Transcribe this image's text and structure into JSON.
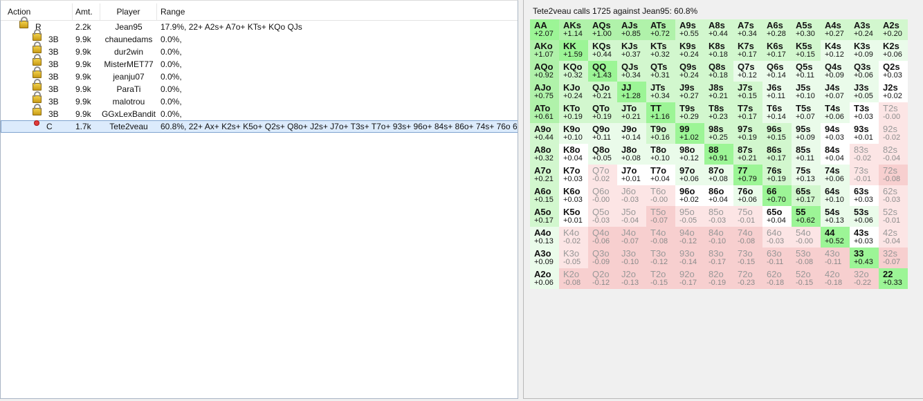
{
  "columns": {
    "action": "Action",
    "amt": "Amt.",
    "player": "Player",
    "range": "Range"
  },
  "rows": [
    {
      "icon": "lock-icon",
      "action": "R",
      "amt": "2.2k",
      "player": "Jean95",
      "range": "17.9%, 22+ A2s+ A7o+ KTs+ KQo QJs"
    },
    {
      "icon": "lock-icon",
      "action": "3B",
      "amt": "9.9k",
      "player": "chaunedams",
      "range": "0.0%,"
    },
    {
      "icon": "lock-icon",
      "action": "3B",
      "amt": "9.9k",
      "player": "dur2win",
      "range": "0.0%,"
    },
    {
      "icon": "lock-icon",
      "action": "3B",
      "amt": "9.9k",
      "player": "MisterMET77",
      "range": "0.0%,"
    },
    {
      "icon": "lock-icon",
      "action": "3B",
      "amt": "9.9k",
      "player": "jeanju07",
      "range": "0.0%,"
    },
    {
      "icon": "lock-icon",
      "action": "3B",
      "amt": "9.9k",
      "player": "ParaTi",
      "range": "0.0%,"
    },
    {
      "icon": "lock-icon",
      "action": "3B",
      "amt": "9.9k",
      "player": "malotrou",
      "range": "0.0%,"
    },
    {
      "icon": "lock-icon",
      "action": "3B",
      "amt": "9.9k",
      "player": "GGxLexBandit",
      "range": "0.0%,"
    },
    {
      "icon": "red-dot-icon",
      "action": "C",
      "amt": "1.7k",
      "player": "Tete2veau",
      "range": "60.8%, 22+ Ax+ K2s+ K5o+ Q2s+ Q8o+ J2s+ J7o+ T3s+ T7o+ 93s+ 96o+ 84s+ 86o+ 74s+ 76o 63s+ 6"
    }
  ],
  "colors": {
    "pocket": "#9cf596",
    "high": "#b0f2aa",
    "mid": "#d2f7ce",
    "low": "#eafbea",
    "neutral": "#ffffff",
    "neg_low": "#fce5e5",
    "neg_high": "#f7cfcf"
  },
  "matrix": {
    "title": "Tete2veau calls 1725 against Jean95: 60.8%",
    "rows": [
      [
        [
          "AA",
          "+2.07"
        ],
        [
          "AKs",
          "+1.14"
        ],
        [
          "AQs",
          "+1.00"
        ],
        [
          "AJs",
          "+0.85"
        ],
        [
          "ATs",
          "+0.72"
        ],
        [
          "A9s",
          "+0.55"
        ],
        [
          "A8s",
          "+0.44"
        ],
        [
          "A7s",
          "+0.34"
        ],
        [
          "A6s",
          "+0.28"
        ],
        [
          "A5s",
          "+0.30"
        ],
        [
          "A4s",
          "+0.27"
        ],
        [
          "A3s",
          "+0.24"
        ],
        [
          "A2s",
          "+0.20"
        ]
      ],
      [
        [
          "AKo",
          "+1.07"
        ],
        [
          "KK",
          "+1.59"
        ],
        [
          "KQs",
          "+0.44"
        ],
        [
          "KJs",
          "+0.37"
        ],
        [
          "KTs",
          "+0.32"
        ],
        [
          "K9s",
          "+0.24"
        ],
        [
          "K8s",
          "+0.18"
        ],
        [
          "K7s",
          "+0.17"
        ],
        [
          "K6s",
          "+0.17"
        ],
        [
          "K5s",
          "+0.15"
        ],
        [
          "K4s",
          "+0.12"
        ],
        [
          "K3s",
          "+0.09"
        ],
        [
          "K2s",
          "+0.06"
        ]
      ],
      [
        [
          "AQo",
          "+0.92"
        ],
        [
          "KQo",
          "+0.32"
        ],
        [
          "QQ",
          "+1.43"
        ],
        [
          "QJs",
          "+0.34"
        ],
        [
          "QTs",
          "+0.31"
        ],
        [
          "Q9s",
          "+0.24"
        ],
        [
          "Q8s",
          "+0.18"
        ],
        [
          "Q7s",
          "+0.12"
        ],
        [
          "Q6s",
          "+0.14"
        ],
        [
          "Q5s",
          "+0.11"
        ],
        [
          "Q4s",
          "+0.09"
        ],
        [
          "Q3s",
          "+0.06"
        ],
        [
          "Q2s",
          "+0.03"
        ]
      ],
      [
        [
          "AJo",
          "+0.75"
        ],
        [
          "KJo",
          "+0.24"
        ],
        [
          "QJo",
          "+0.21"
        ],
        [
          "JJ",
          "+1.28"
        ],
        [
          "JTs",
          "+0.34"
        ],
        [
          "J9s",
          "+0.27"
        ],
        [
          "J8s",
          "+0.21"
        ],
        [
          "J7s",
          "+0.15"
        ],
        [
          "J6s",
          "+0.11"
        ],
        [
          "J5s",
          "+0.10"
        ],
        [
          "J4s",
          "+0.07"
        ],
        [
          "J3s",
          "+0.05"
        ],
        [
          "J2s",
          "+0.02"
        ]
      ],
      [
        [
          "ATo",
          "+0.61"
        ],
        [
          "KTo",
          "+0.19"
        ],
        [
          "QTo",
          "+0.19"
        ],
        [
          "JTo",
          "+0.21"
        ],
        [
          "TT",
          "+1.16"
        ],
        [
          "T9s",
          "+0.29"
        ],
        [
          "T8s",
          "+0.23"
        ],
        [
          "T7s",
          "+0.17"
        ],
        [
          "T6s",
          "+0.14"
        ],
        [
          "T5s",
          "+0.07"
        ],
        [
          "T4s",
          "+0.06"
        ],
        [
          "T3s",
          "+0.03"
        ],
        [
          "T2s",
          "-0.00"
        ]
      ],
      [
        [
          "A9o",
          "+0.44"
        ],
        [
          "K9o",
          "+0.10"
        ],
        [
          "Q9o",
          "+0.11"
        ],
        [
          "J9o",
          "+0.14"
        ],
        [
          "T9o",
          "+0.16"
        ],
        [
          "99",
          "+1.02"
        ],
        [
          "98s",
          "+0.25"
        ],
        [
          "97s",
          "+0.19"
        ],
        [
          "96s",
          "+0.15"
        ],
        [
          "95s",
          "+0.09"
        ],
        [
          "94s",
          "+0.03"
        ],
        [
          "93s",
          "+0.01"
        ],
        [
          "92s",
          "-0.02"
        ]
      ],
      [
        [
          "A8o",
          "+0.32"
        ],
        [
          "K8o",
          "+0.04"
        ],
        [
          "Q8o",
          "+0.05"
        ],
        [
          "J8o",
          "+0.08"
        ],
        [
          "T8o",
          "+0.10"
        ],
        [
          "98o",
          "+0.12"
        ],
        [
          "88",
          "+0.91"
        ],
        [
          "87s",
          "+0.21"
        ],
        [
          "86s",
          "+0.17"
        ],
        [
          "85s",
          "+0.11"
        ],
        [
          "84s",
          "+0.04"
        ],
        [
          "83s",
          "-0.02"
        ],
        [
          "82s",
          "-0.04"
        ]
      ],
      [
        [
          "A7o",
          "+0.21"
        ],
        [
          "K7o",
          "+0.03"
        ],
        [
          "Q7o",
          "-0.02"
        ],
        [
          "J7o",
          "+0.01"
        ],
        [
          "T7o",
          "+0.04"
        ],
        [
          "97o",
          "+0.06"
        ],
        [
          "87o",
          "+0.08"
        ],
        [
          "77",
          "+0.79"
        ],
        [
          "76s",
          "+0.19"
        ],
        [
          "75s",
          "+0.13"
        ],
        [
          "74s",
          "+0.06"
        ],
        [
          "73s",
          "-0.01"
        ],
        [
          "72s",
          "-0.08"
        ]
      ],
      [
        [
          "A6o",
          "+0.15"
        ],
        [
          "K6o",
          "+0.03"
        ],
        [
          "Q6o",
          "-0.00"
        ],
        [
          "J6o",
          "-0.03"
        ],
        [
          "T6o",
          "-0.00"
        ],
        [
          "96o",
          "+0.02"
        ],
        [
          "86o",
          "+0.04"
        ],
        [
          "76o",
          "+0.06"
        ],
        [
          "66",
          "+0.70"
        ],
        [
          "65s",
          "+0.17"
        ],
        [
          "64s",
          "+0.10"
        ],
        [
          "63s",
          "+0.03"
        ],
        [
          "62s",
          "-0.03"
        ]
      ],
      [
        [
          "A5o",
          "+0.17"
        ],
        [
          "K5o",
          "+0.01"
        ],
        [
          "Q5o",
          "-0.03"
        ],
        [
          "J5o",
          "-0.04"
        ],
        [
          "T5o",
          "-0.07"
        ],
        [
          "95o",
          "-0.05"
        ],
        [
          "85o",
          "-0.03"
        ],
        [
          "75o",
          "-0.01"
        ],
        [
          "65o",
          "+0.04"
        ],
        [
          "55",
          "+0.62"
        ],
        [
          "54s",
          "+0.13"
        ],
        [
          "53s",
          "+0.06"
        ],
        [
          "52s",
          "-0.01"
        ]
      ],
      [
        [
          "A4o",
          "+0.13"
        ],
        [
          "K4o",
          "-0.02"
        ],
        [
          "Q4o",
          "-0.06"
        ],
        [
          "J4o",
          "-0.07"
        ],
        [
          "T4o",
          "-0.08"
        ],
        [
          "94o",
          "-0.12"
        ],
        [
          "84o",
          "-0.10"
        ],
        [
          "74o",
          "-0.08"
        ],
        [
          "64o",
          "-0.03"
        ],
        [
          "54o",
          "-0.00"
        ],
        [
          "44",
          "+0.52"
        ],
        [
          "43s",
          "+0.03"
        ],
        [
          "42s",
          "-0.04"
        ]
      ],
      [
        [
          "A3o",
          "+0.09"
        ],
        [
          "K3o",
          "-0.05"
        ],
        [
          "Q3o",
          "-0.09"
        ],
        [
          "J3o",
          "-0.10"
        ],
        [
          "T3o",
          "-0.12"
        ],
        [
          "93o",
          "-0.14"
        ],
        [
          "83o",
          "-0.17"
        ],
        [
          "73o",
          "-0.15"
        ],
        [
          "63o",
          "-0.11"
        ],
        [
          "53o",
          "-0.08"
        ],
        [
          "43o",
          "-0.11"
        ],
        [
          "33",
          "+0.43"
        ],
        [
          "32s",
          "-0.07"
        ]
      ],
      [
        [
          "A2o",
          "+0.06"
        ],
        [
          "K2o",
          "-0.08"
        ],
        [
          "Q2o",
          "-0.12"
        ],
        [
          "J2o",
          "-0.13"
        ],
        [
          "T2o",
          "-0.15"
        ],
        [
          "92o",
          "-0.17"
        ],
        [
          "82o",
          "-0.19"
        ],
        [
          "72o",
          "-0.23"
        ],
        [
          "62o",
          "-0.18"
        ],
        [
          "52o",
          "-0.15"
        ],
        [
          "42o",
          "-0.18"
        ],
        [
          "32o",
          "-0.22"
        ],
        [
          "22",
          "+0.33"
        ]
      ]
    ]
  }
}
